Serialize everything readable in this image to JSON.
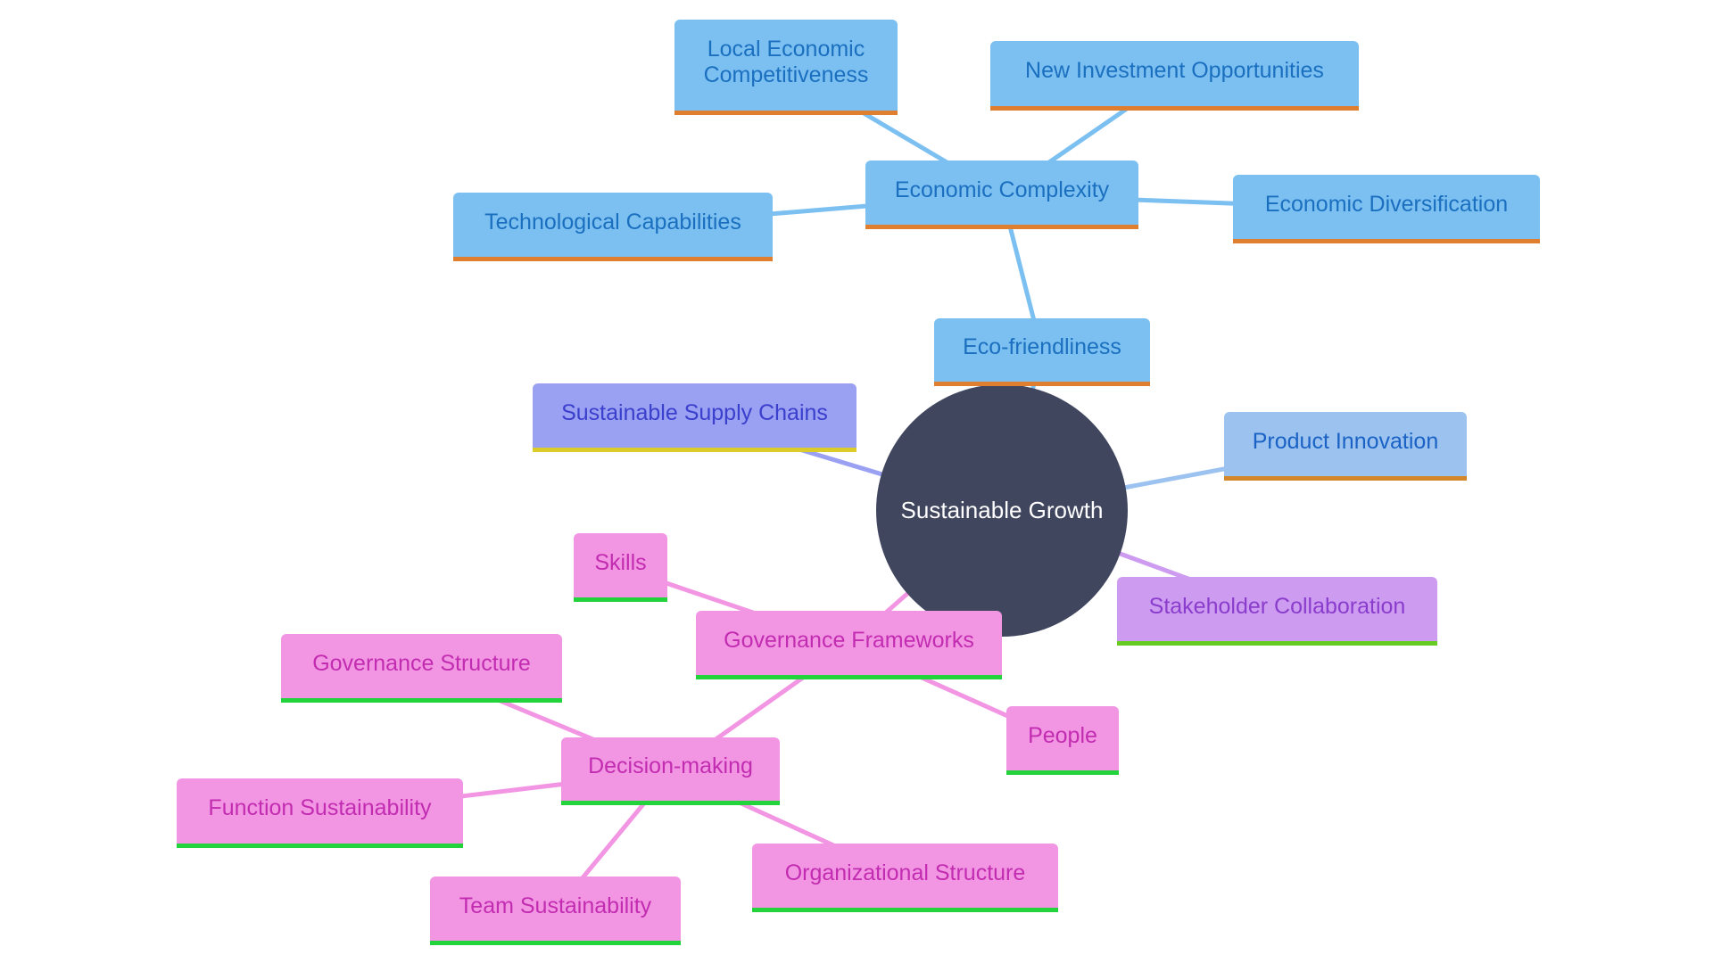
{
  "diagram": {
    "type": "mindmap",
    "root": {
      "id": "n-root",
      "label": "Sustainable Growth",
      "fill": "#41465f",
      "text_color": "#ffffff"
    },
    "palettes": {
      "blue": {
        "fill": "#7cc0f2",
        "text": "#1a6fbf",
        "border": "#e07e30",
        "edge": "#7cc0f2"
      },
      "light_blue": {
        "fill": "#9cc3f0",
        "text": "#1a62c4",
        "border": "#d4862a",
        "edge": "#9cc3f0"
      },
      "indigo": {
        "fill": "#9aa0f2",
        "text": "#3a3fcc",
        "border": "#dccc2a",
        "edge": "#9aa0f2"
      },
      "purple": {
        "fill": "#cd9cf0",
        "text": "#8a3ccc",
        "border": "#66cc22",
        "edge": "#cd9cf0"
      },
      "pink": {
        "fill": "#f296e4",
        "text": "#c22cb0",
        "border": "#22d33c",
        "edge": "#f296e4"
      }
    },
    "nodes": [
      {
        "id": "n-eco",
        "label": "Eco-friendliness",
        "parent": "n-root",
        "palette": "blue"
      },
      {
        "id": "n-econ-complexity",
        "label": "Economic Complexity",
        "parent": "n-eco",
        "palette": "blue"
      },
      {
        "id": "n-local-econ",
        "label": "Local Economic Competitiveness",
        "parent": "n-econ-complexity",
        "palette": "blue"
      },
      {
        "id": "n-new-invest",
        "label": "New Investment Opportunities",
        "parent": "n-econ-complexity",
        "palette": "blue"
      },
      {
        "id": "n-tech-cap",
        "label": "Technological Capabilities",
        "parent": "n-econ-complexity",
        "palette": "blue"
      },
      {
        "id": "n-econ-div",
        "label": "Economic Diversification",
        "parent": "n-econ-complexity",
        "palette": "blue"
      },
      {
        "id": "n-product",
        "label": "Product Innovation",
        "parent": "n-root",
        "palette": "light_blue"
      },
      {
        "id": "n-supply",
        "label": "Sustainable Supply Chains",
        "parent": "n-root",
        "palette": "indigo"
      },
      {
        "id": "n-stakeholder",
        "label": "Stakeholder Collaboration",
        "parent": "n-root",
        "palette": "purple"
      },
      {
        "id": "n-gov-frameworks",
        "label": "Governance Frameworks",
        "parent": "n-root",
        "palette": "pink"
      },
      {
        "id": "n-skills",
        "label": "Skills",
        "parent": "n-gov-frameworks",
        "palette": "pink"
      },
      {
        "id": "n-people",
        "label": "People",
        "parent": "n-gov-frameworks",
        "palette": "pink"
      },
      {
        "id": "n-decision",
        "label": "Decision-making",
        "parent": "n-gov-frameworks",
        "palette": "pink"
      },
      {
        "id": "n-gov-structure",
        "label": "Governance Structure",
        "parent": "n-decision",
        "palette": "pink"
      },
      {
        "id": "n-function",
        "label": "Function Sustainability",
        "parent": "n-decision",
        "palette": "pink"
      },
      {
        "id": "n-team",
        "label": "Team Sustainability",
        "parent": "n-decision",
        "palette": "pink"
      },
      {
        "id": "n-org",
        "label": "Organizational Structure",
        "parent": "n-decision",
        "palette": "pink"
      }
    ]
  }
}
